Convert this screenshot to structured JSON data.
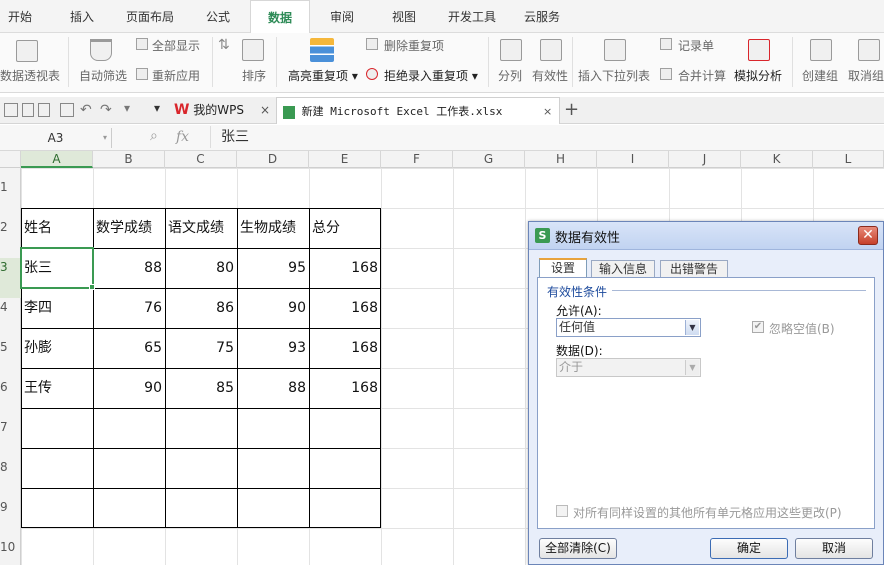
{
  "menu_tabs": [
    "开始",
    "插入",
    "页面布局",
    "公式",
    "数据",
    "审阅",
    "视图",
    "开发工具",
    "云服务"
  ],
  "ribbon": {
    "pivot": "数据透视表",
    "autofilter": "自动筛选",
    "show_all": "全部显示",
    "reapply": "重新应用",
    "sort": "排序",
    "highlight_dup": "高亮重复项",
    "remove_dup": "删除重复项",
    "reject_dup": "拒绝录入重复项",
    "split": "分列",
    "validity": "有效性",
    "dropdown": "插入下拉列表",
    "record_form": "记录单",
    "consolidate": "合并计算",
    "what_if": "模拟分析",
    "group": "创建组",
    "ungroup": "取消组"
  },
  "doc_tabs": {
    "wps": "我的WPS",
    "file": "新建 Microsoft Excel 工作表.xlsx"
  },
  "formula_bar": {
    "cell_ref": "A3",
    "fx": "fx",
    "value": "张三"
  },
  "columns": [
    "A",
    "B",
    "C",
    "D",
    "E",
    "F",
    "G",
    "H",
    "I",
    "J",
    "K",
    "L"
  ],
  "rows": [
    "1",
    "2",
    "3",
    "4",
    "5",
    "6",
    "7",
    "8",
    "9",
    "10"
  ],
  "table": {
    "headers": [
      "姓名",
      "数学成绩",
      "语文成绩",
      "生物成绩",
      "总分"
    ],
    "rows": [
      [
        "张三",
        "88",
        "80",
        "95",
        "168"
      ],
      [
        "李四",
        "76",
        "86",
        "90",
        "168"
      ],
      [
        "孙膨",
        "65",
        "75",
        "93",
        "168"
      ],
      [
        "王传",
        "90",
        "85",
        "88",
        "168"
      ]
    ]
  },
  "dialog": {
    "title": "数据有效性",
    "tabs": [
      "设置",
      "输入信息",
      "出错警告"
    ],
    "section": "有效性条件",
    "allow_label": "允许(A):",
    "allow_value": "任何值",
    "ignore_blank": "忽略空值(B)",
    "data_label": "数据(D):",
    "data_value": "介于",
    "apply_all": "对所有同样设置的其他所有单元格应用这些更改(P)",
    "clear_all": "全部清除(C)",
    "ok": "确定",
    "cancel": "取消"
  },
  "colors": {
    "accent": "#2e8b57",
    "wps_red": "#d9262c",
    "dialog_bg": "#e8eefa"
  }
}
